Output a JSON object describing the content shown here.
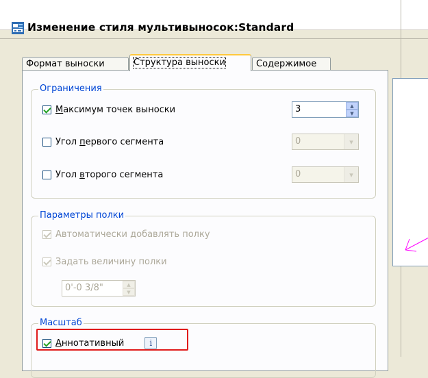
{
  "window": {
    "title": "Изменение стиля мультивыносок:Standard"
  },
  "tabs": [
    {
      "label": "Формат выноски",
      "active": false
    },
    {
      "label": "Структура выноски",
      "active": true
    },
    {
      "label": "Содержимое",
      "active": false
    }
  ],
  "constraints": {
    "title": "Ограничения",
    "max_points": {
      "label_accel": "М",
      "label_rest": "аксимум точек выноски",
      "checked": true,
      "value": "3"
    },
    "first_angle": {
      "label_pre": "Угол ",
      "label_accel": "п",
      "label_rest": "ервого сегмента",
      "checked": false,
      "value": "0"
    },
    "second_angle": {
      "label_pre": "Угол ",
      "label_accel": "в",
      "label_rest": "торого сегмента",
      "checked": false,
      "value": "0"
    }
  },
  "landing": {
    "title": "Параметры полки",
    "auto_landing": {
      "label": "Автоматически добавлять полку",
      "checked": true
    },
    "set_distance": {
      "label": "Задать величину полки",
      "checked": true
    },
    "distance_value": "0'-0 3/8\""
  },
  "scale": {
    "title": "Масштаб",
    "annotative": {
      "label_accel": "А",
      "label_rest": "ннотативный",
      "checked": true
    },
    "info_icon": "i"
  },
  "colors": {
    "accent": "#0046d5",
    "highlight": "#e01b1b",
    "preview_line": "#ff00ff"
  }
}
